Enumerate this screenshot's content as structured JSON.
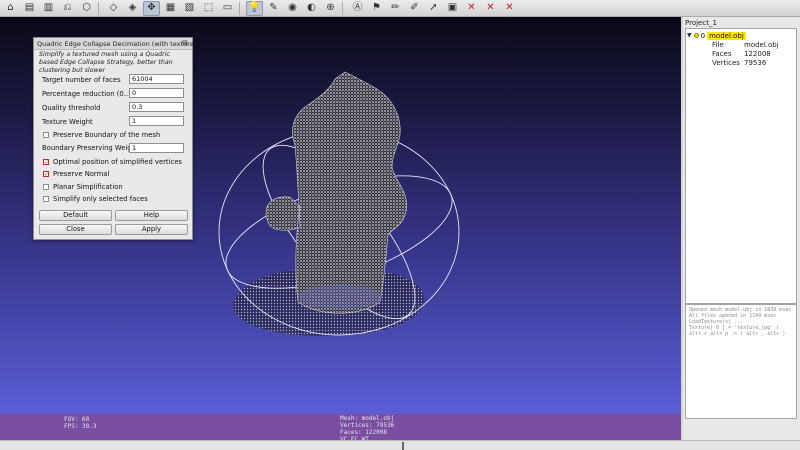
{
  "toolbar": {
    "icons": [
      "⌂",
      "▤",
      "▥",
      "⎌",
      "⬡",
      "◇",
      "◈",
      "✥",
      "▦",
      "▧",
      "⬚",
      "▭",
      "💡",
      "✎",
      "◉",
      "◐",
      "⊕",
      "Ⓐ",
      "⚑",
      "✏",
      "✐",
      "➚",
      "▣",
      "✕",
      "✕",
      "✕"
    ]
  },
  "dialog": {
    "title": "Quadric Edge Collapse Decimation (with texture)",
    "close": "⊠",
    "description": "Simplify a textured mesh using a Quadric based Edge Collapse Strategy, better than clustering but slower",
    "params": [
      {
        "label": "Target number of faces",
        "value": "61004"
      },
      {
        "label": "Percentage reduction (0..1)",
        "value": "0"
      },
      {
        "label": "Quality threshold",
        "value": "0.3"
      },
      {
        "label": "Texture Weight",
        "value": "1"
      }
    ],
    "preserve_boundary": {
      "label": "Preserve Boundary of the mesh",
      "checked": false
    },
    "boundary_weight": {
      "label": "Boundary Preserving Weight",
      "value": "1"
    },
    "checks": [
      {
        "label": "Optimal position of simplified vertices",
        "checked": true
      },
      {
        "label": "Preserve Normal",
        "checked": true
      },
      {
        "label": "Planar Simplification",
        "checked": false
      },
      {
        "label": "Simplify only selected faces",
        "checked": false
      }
    ],
    "buttons": {
      "default": "Default",
      "help": "Help",
      "close": "Close",
      "apply": "Apply"
    }
  },
  "info": {
    "fov": "FOV: 60",
    "fps": "FPS:   30.3",
    "mesh": "Mesh: model.obj",
    "vertices": "Vertices: 79536",
    "faces": "Faces: 122008",
    "flags": "VC FC WT"
  },
  "panel": {
    "project": "Project_1",
    "layer_index": "0",
    "layer_name": "model.obj",
    "attrs": [
      {
        "k": "File",
        "v": "model.obj"
      },
      {
        "k": "Faces",
        "v": "122008"
      },
      {
        "k": "Vertices",
        "v": "79536"
      }
    ],
    "log": [
      "Opened mesh model.obj in 1838 msec",
      "All files opened in 1149 msec",
      "LoadTexture(s) ...",
      "Texture[ 0 ] = 'texture.jpg' ( ",
      "alt+ + alt+ p -> ( alt+ , alt+ )"
    ]
  },
  "colors": {
    "viewport_top": "#0a0918",
    "viewport_bottom": "#5a5ed6",
    "infobar": "#7a4ea0",
    "selected_layer": "#ffe800"
  }
}
